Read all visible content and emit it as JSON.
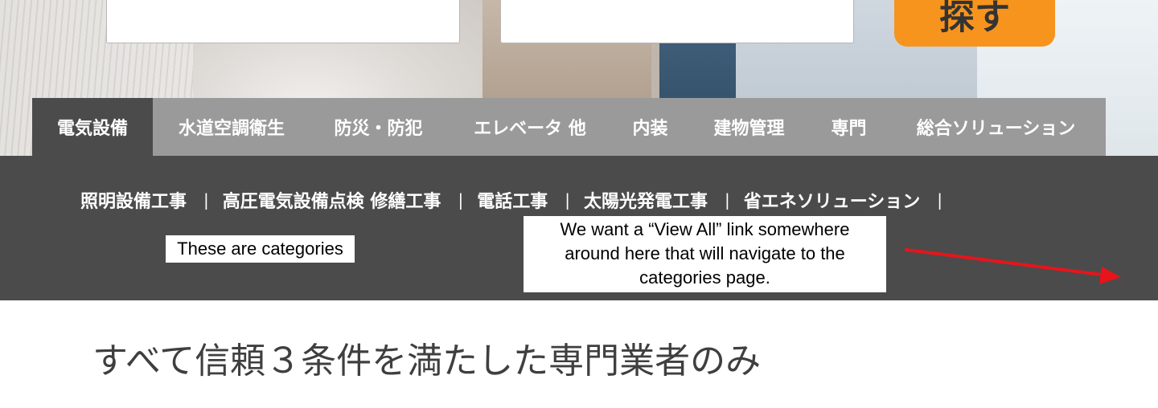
{
  "search": {
    "button_label": "探す"
  },
  "tabs": [
    {
      "label": "電気設備",
      "active": true
    },
    {
      "label": "水道空調衛生",
      "active": false
    },
    {
      "label": "防災・防犯",
      "active": false
    },
    {
      "label": "エレベータ 他",
      "active": false
    },
    {
      "label": "内装",
      "active": false
    },
    {
      "label": "建物管理",
      "active": false
    },
    {
      "label": "専門",
      "active": false
    },
    {
      "label": "総合ソリューション",
      "active": false
    }
  ],
  "subnav": {
    "items": [
      {
        "label": "照明設備工事"
      },
      {
        "label": "高圧電気設備点検 修繕工事"
      },
      {
        "label": "電話工事"
      },
      {
        "label": "太陽光発電工事"
      },
      {
        "label": "省エネソリューション"
      }
    ],
    "separator": "|"
  },
  "annotations": {
    "categories_note": "These are categories",
    "view_all_note_lines": [
      "We want a “View All” link somewhere",
      "around here that will navigate to the",
      "categories page."
    ],
    "arrow_color": "#e8141b"
  },
  "main": {
    "heading": "すべて信頼３条件を満たした専門業者のみ"
  },
  "colors": {
    "accent_orange": "#f7941d",
    "tab_bar": "#9a9a9a",
    "active_dark": "#4b4b4b"
  }
}
